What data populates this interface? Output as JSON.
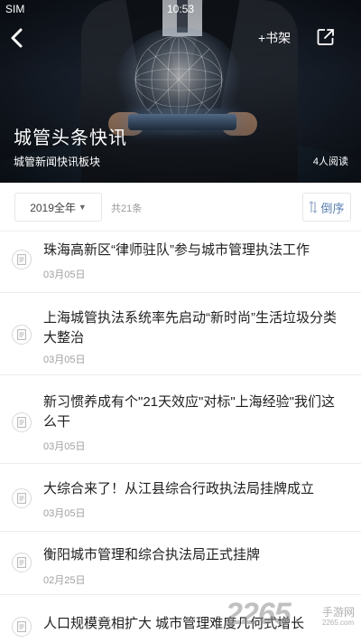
{
  "status_bar": {
    "carrier": "SIM",
    "time": "10:53"
  },
  "header": {
    "bookshelf_label": "+书架",
    "title": "城管头条快讯",
    "subtitle": "城管新闻快讯板块",
    "readers": "4人阅读"
  },
  "filter": {
    "year_label": "2019全年",
    "count_label": "共21条",
    "sort_label": "倒序"
  },
  "news": [
    {
      "title": "珠海高新区“律师驻队”参与城市管理执法工作",
      "date": "03月05日"
    },
    {
      "title": "上海城管执法系统率先启动“新时尚”生活垃圾分类大整治",
      "date": "03月05日"
    },
    {
      "title": "新习惯养成有个\"21天效应\"对标\"上海经验\"我们这么干",
      "date": "03月05日"
    },
    {
      "title": "大综合来了！从江县综合行政执法局挂牌成立",
      "date": "03月05日"
    },
    {
      "title": "衡阳城市管理和综合执法局正式挂牌",
      "date": "02月25日"
    },
    {
      "title": "人口规模竟相扩大 城市管理难度几何式增长",
      "date": ""
    }
  ],
  "watermark": {
    "number": "2265",
    "text": "手游网",
    "url": "2265.com"
  },
  "colors": {
    "accent": "#5a7fb0"
  }
}
